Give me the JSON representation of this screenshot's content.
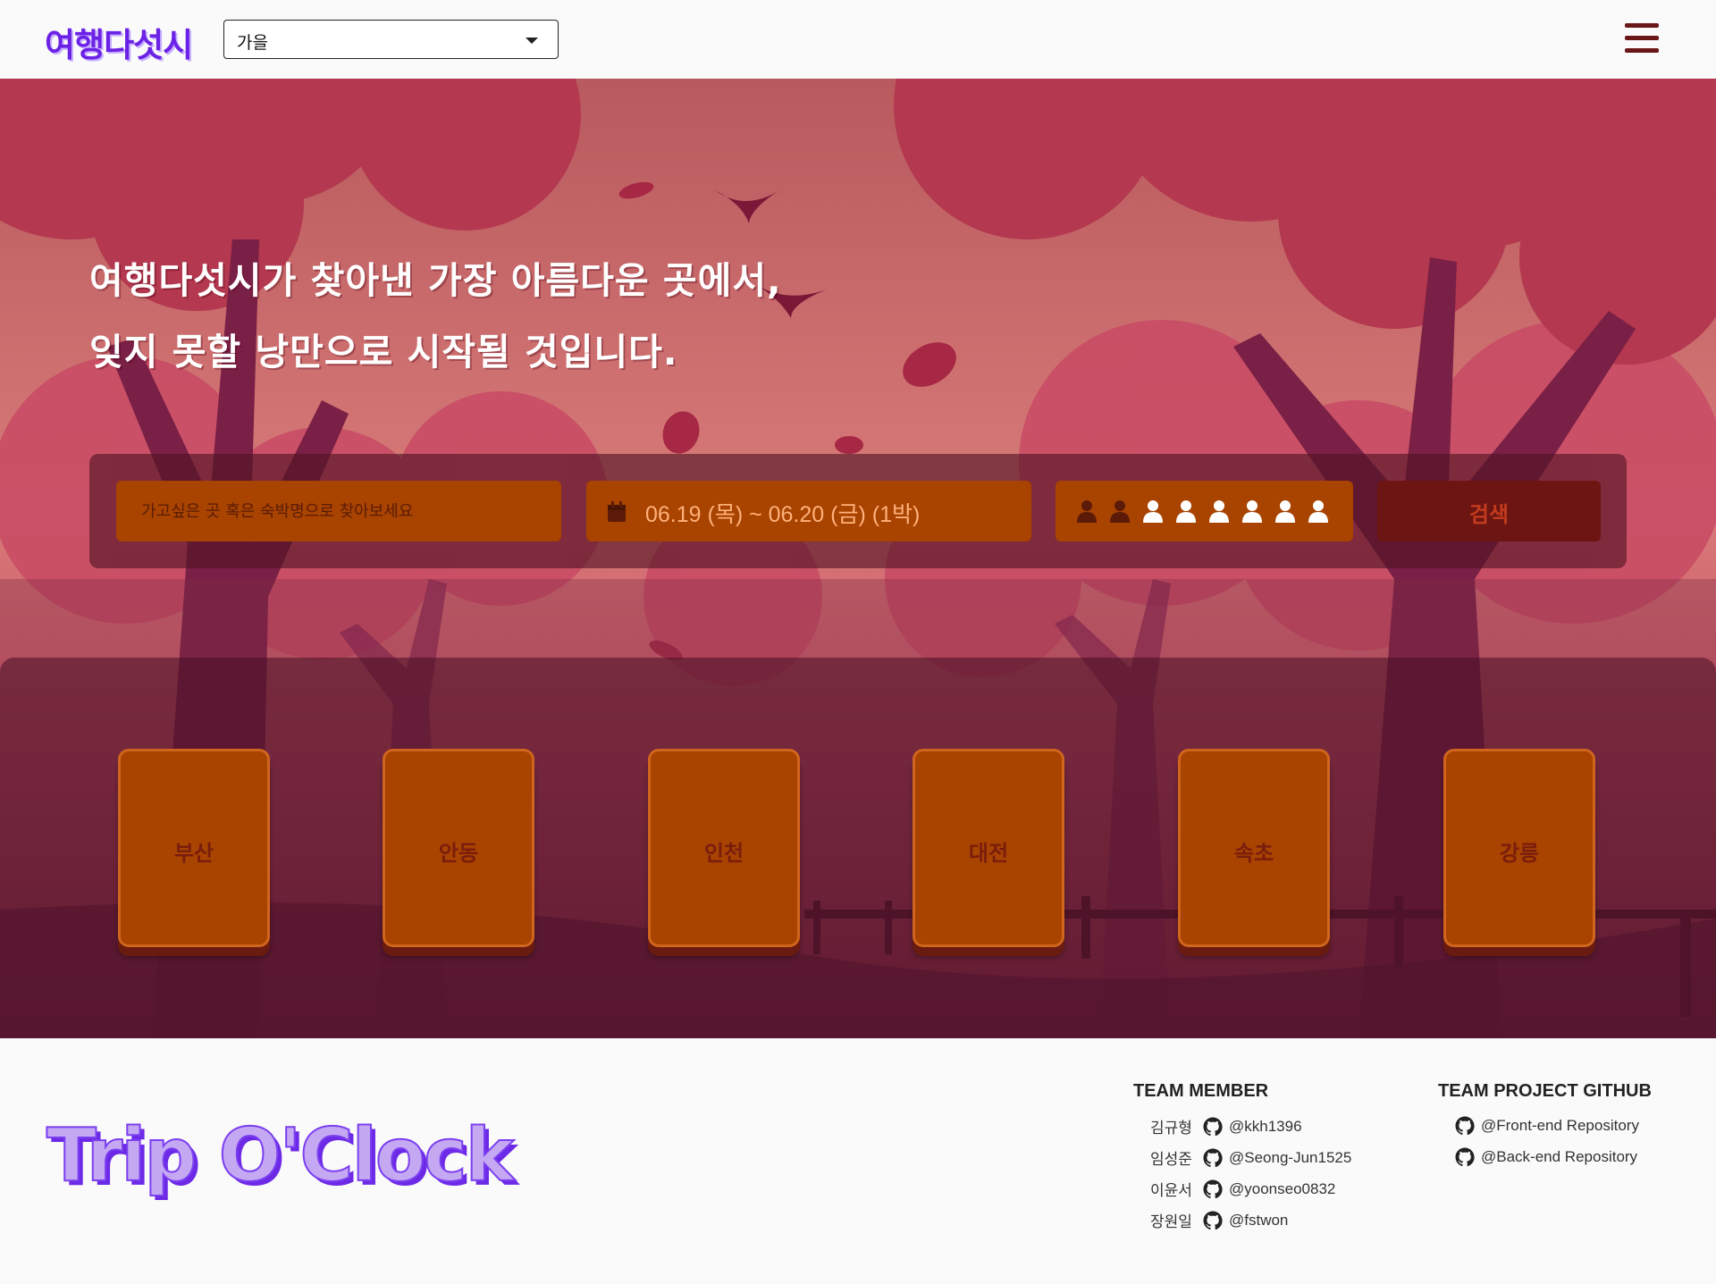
{
  "header": {
    "logo": "여행다섯시",
    "season_select": {
      "selected": "가을"
    },
    "menu_icon": "hamburger-menu-icon"
  },
  "hero": {
    "headline_line1": "여행다섯시가 찾아낸 가장 아름다운 곳에서,",
    "headline_line2": "잊지 못할 낭만으로 시작될 것입니다."
  },
  "search": {
    "destination_placeholder": "가고싶은 곳 혹은 숙박명으로 찾아보세요",
    "date_range": "06.19 (목) ~ 06.20 (금) (1박)",
    "calendar_icon": "calendar-icon",
    "guests": {
      "selected": 2,
      "max": 8,
      "icon": "person-icon"
    },
    "search_label": "검색"
  },
  "cities": [
    "부산",
    "안동",
    "인천",
    "대전",
    "속초",
    "강릉"
  ],
  "footer": {
    "brand": "Trip O'Clock",
    "team_title": "TEAM MEMBER",
    "members": [
      {
        "name": "김규형",
        "github": "@kkh1396"
      },
      {
        "name": "임성준",
        "github": "@Seong-Jun1525"
      },
      {
        "name": "이윤서",
        "github": "@yoonseo0832"
      },
      {
        "name": "장원일",
        "github": "@fstwon"
      }
    ],
    "repo_title": "TEAM PROJECT GITHUB",
    "repos": [
      "@Front-end Repository",
      "@Back-end Repository"
    ],
    "github_icon": "github-icon"
  },
  "colors": {
    "brand_purple": "#6c22e6",
    "card_orange": "#a84300",
    "search_button": "#6d1512",
    "hero_sky": "#c4566a"
  }
}
